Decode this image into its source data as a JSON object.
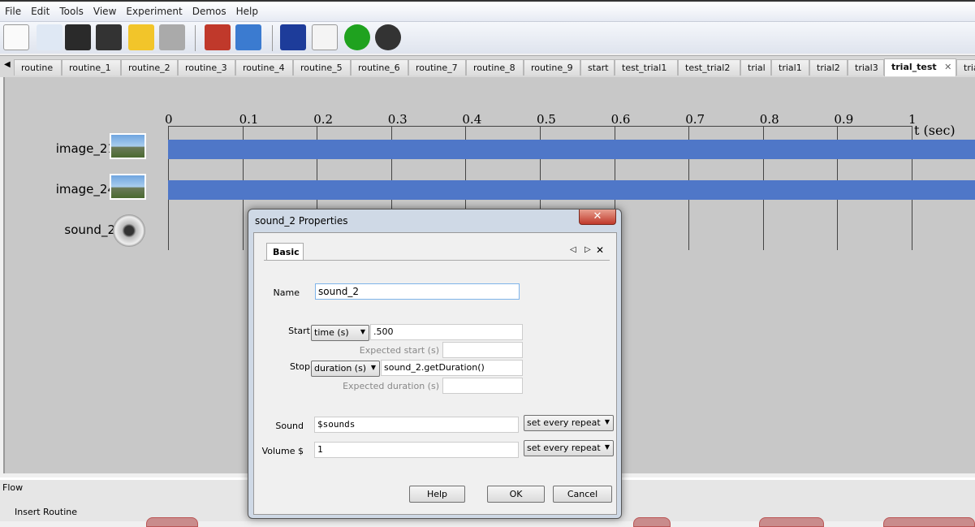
{
  "menu": [
    "File",
    "Edit",
    "Tools",
    "View",
    "Experiment",
    "Demos",
    "Help"
  ],
  "toolbar": [
    {
      "icon": "new-file-icon"
    },
    {
      "icon": "open-folder-icon"
    },
    {
      "icon": "save-icon"
    },
    {
      "icon": "save-as-icon"
    },
    {
      "icon": "undo-icon"
    },
    {
      "icon": "redo-icon"
    },
    {
      "icon": "preferences-icon"
    },
    {
      "icon": "monitor-center-icon"
    },
    {
      "icon": "experiment-settings-icon"
    },
    {
      "icon": "compile-script-icon"
    },
    {
      "icon": "run-icon"
    },
    {
      "icon": "stop-icon"
    }
  ],
  "tabs": [
    "routine",
    "routine_1",
    "routine_2",
    "routine_3",
    "routine_4",
    "routine_5",
    "routine_6",
    "routine_7",
    "routine_8",
    "routine_9",
    "start",
    "test_trial1",
    "test_trial2",
    "trial",
    "trial1",
    "trial2",
    "trial3",
    "trial_test",
    "trial"
  ],
  "active_tab": "trial_test",
  "timeline": {
    "ticks": [
      "0",
      "0.1",
      "0.2",
      "0.3",
      "0.4",
      "0.5",
      "0.6",
      "0.7",
      "0.8",
      "0.9",
      "1"
    ],
    "axis_label": "t (sec)",
    "components": [
      {
        "name": "image_21",
        "icon": "image-icon",
        "start": 0,
        "bar_visible": true
      },
      {
        "name": "image_24",
        "icon": "image-icon",
        "start": 0,
        "bar_visible": true
      },
      {
        "name": "sound_2",
        "icon": "speaker-icon",
        "start": 0.5,
        "bar_visible": false
      }
    ],
    "bar_color": "#4f77c8"
  },
  "flow": {
    "title": "Flow",
    "insert_routine": "Insert Routine"
  },
  "dialog": {
    "title": "sound_2 Properties",
    "tab": "Basic",
    "name_label": "Name",
    "name_value": "sound_2",
    "start_label": "Start",
    "start_type": "time (s)",
    "start_value": ".500",
    "expected_start_label": "Expected start (s)",
    "expected_start_value": "",
    "stop_label": "Stop",
    "stop_type": "duration (s)",
    "stop_value": "sound_2.getDuration()",
    "expected_duration_label": "Expected duration (s)",
    "expected_duration_value": "",
    "sound_label": "Sound",
    "sound_value": "$sounds",
    "sound_update": "set every repeat",
    "volume_label": "Volume $",
    "volume_value": "1",
    "volume_update": "set every repeat",
    "help": "Help",
    "ok": "OK",
    "cancel": "Cancel"
  }
}
